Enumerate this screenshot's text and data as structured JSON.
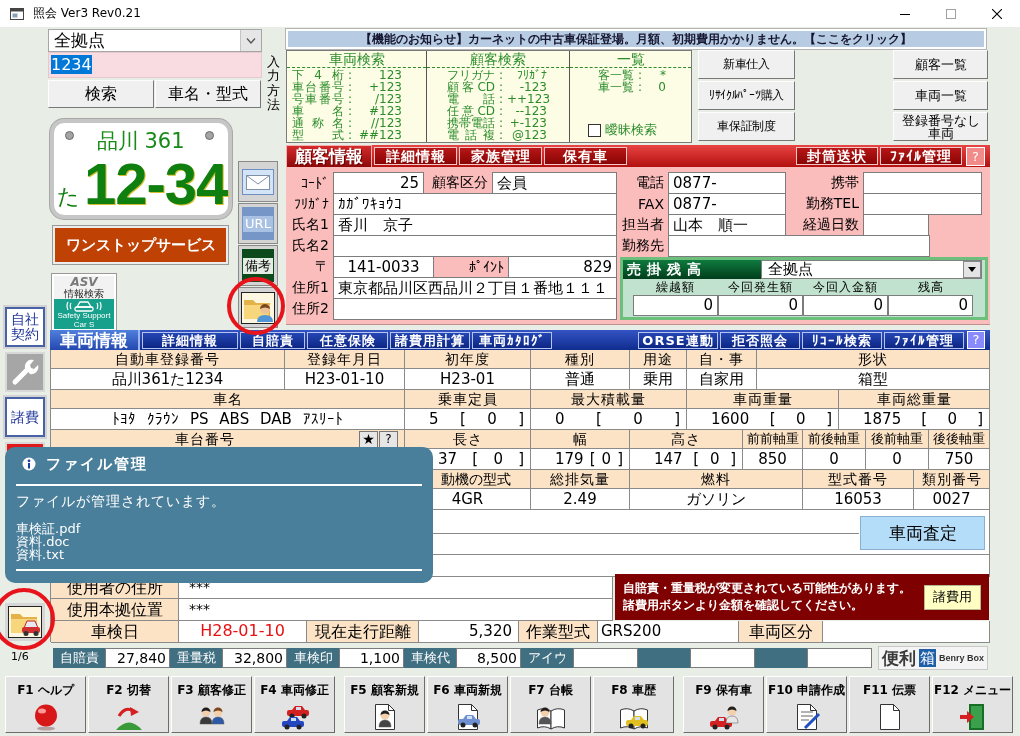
{
  "window": {
    "title": "照会 Ver3 Rev0.21"
  },
  "search": {
    "location": "全拠点",
    "query": "1234",
    "query_selected": true,
    "buttons": [
      "検索",
      "車名・型式"
    ],
    "input_method": "入力方法"
  },
  "plate": {
    "region": "品川",
    "class_number": "361",
    "kana": "た",
    "number": "12-34"
  },
  "one_stop_button": "ワンストップサービス",
  "asv_badge": {
    "title": "ASV",
    "subtitle": "情報検索",
    "caption": "Safety Support Car S"
  },
  "side_buttons": [
    {
      "kind": "mail",
      "highlighted": false
    },
    {
      "kind": "url",
      "label": "URL",
      "highlighted": false
    },
    {
      "kind": "note",
      "label": "備考",
      "highlighted": false
    },
    {
      "kind": "folder_person",
      "highlighted": true
    }
  ],
  "notice": "【機能のお知らせ】カーネットの中古車保証登場。月額、初期費用かかりません。【ここをクリック】",
  "search_help": {
    "separator": ":",
    "columns": [
      {
        "title": "車両検索",
        "entries": [
          {
            "label": "下4桁",
            "value": "123"
          },
          {
            "label": "車台番号",
            "value": "+123"
          },
          {
            "label": "号車番号",
            "value": "/123"
          },
          {
            "label": "車名",
            "value": "#123"
          },
          {
            "label": "通称名",
            "value": "//123"
          },
          {
            "label": "型式",
            "value": "##123"
          }
        ]
      },
      {
        "title": "顧客検索",
        "entries": [
          {
            "label": "フリガナ",
            "value": "ﾌﾘｶﾞﾅ"
          },
          {
            "label": "顧客CD",
            "value": "-123"
          },
          {
            "label": "電話",
            "value": "++123"
          },
          {
            "label": "任意CD",
            "value": "--123"
          },
          {
            "label": "携帯電話",
            "value": "+-123"
          },
          {
            "label": "電話複",
            "value": "@123"
          }
        ]
      },
      {
        "title": "一覧",
        "entries": [
          {
            "label": "客一覧",
            "value": "*"
          },
          {
            "label": "車一覧",
            "value": "0"
          }
        ]
      }
    ],
    "fuzzy": {
      "label": "曖昧検索",
      "checked": false
    }
  },
  "action_buttons": {
    "left": [
      "新車仕入",
      "ﾘｻｲｸﾙﾊﾟｰﾂ購入",
      "車保証制度"
    ],
    "right": [
      "顧客一覧",
      "車両一覧",
      "登録番号なし車両"
    ]
  },
  "customer": {
    "title": "顧客情報",
    "tabs": [
      "詳細情報",
      "家族管理",
      "保有車"
    ],
    "tools": [
      "封筒送状",
      "ﾌｧｲﾙ管理"
    ],
    "help": "?",
    "left_rows": [
      [
        {
          "label": "ｺｰﾄﾞ",
          "value": "25"
        },
        {
          "label": "顧客区分",
          "value": "会員"
        }
      ],
      [
        {
          "label": "ﾌﾘｶﾞﾅ",
          "value": "ｶｶﾞﾜｷｮｳｺ"
        }
      ],
      [
        {
          "label": "氏名1",
          "value": "香川　京子"
        }
      ],
      [
        {
          "label": "氏名2"
        }
      ],
      [
        {
          "label": "〒",
          "value": "141-0033"
        },
        {
          "label": "ﾎﾟｲﾝﾄ",
          "value": "829"
        }
      ],
      [
        {
          "label": "住所1",
          "value": "東京都品川区西品川２丁目１番地１１１"
        }
      ],
      [
        {
          "label": "住所2"
        }
      ]
    ],
    "right_rows": [
      [
        {
          "label": "電話",
          "value": "0877-"
        },
        {
          "label": "携帯"
        }
      ],
      [
        {
          "label": "FAX",
          "value": "0877-"
        },
        {
          "label": "勤務TEL"
        }
      ],
      [
        {
          "label": "担当者",
          "value": "山本　順一"
        },
        {
          "label": "経過日数"
        }
      ],
      [
        {
          "label": "勤務先"
        }
      ]
    ],
    "balance": {
      "title": "売掛残高",
      "location": "全拠点",
      "columns": [
        {
          "label": "繰越額",
          "value": "0"
        },
        {
          "label": "今回発生額",
          "value": "0"
        },
        {
          "label": "今回入金額",
          "value": "0"
        },
        {
          "label": "残高",
          "value": "0"
        }
      ]
    }
  },
  "left_tools": [
    {
      "kind": "contract",
      "label": "自社契約",
      "highlighted": false
    },
    {
      "kind": "wrench",
      "highlighted": false
    },
    {
      "kind": "fees",
      "label": "諸費",
      "highlighted": false
    },
    {
      "kind": "alert",
      "highlighted": false
    },
    {
      "kind": "folder_car",
      "highlighted": true
    }
  ],
  "vehicle": {
    "title": "車両情報",
    "tabs": [
      "詳細情報",
      "自賠責",
      "任意保険",
      "諸費用計算",
      "車両ｶﾀﾛｸﾞ"
    ],
    "tools": [
      "ORSE連動",
      "拒否照会",
      "ﾘｺｰﾙ検索",
      "ﾌｧｲﾙ管理"
    ],
    "help": "?",
    "bands": [
      [
        {
          "kind": "text",
          "label": "自動車登録番号",
          "value": "品川361た1234"
        },
        {
          "kind": "text",
          "label": "登録年月日",
          "value": "H23-01-10"
        },
        {
          "kind": "text",
          "label": "初年度",
          "value": "H23-01"
        },
        {
          "kind": "text",
          "label": "種別",
          "value": "普通"
        },
        {
          "kind": "text",
          "label": "用途",
          "value": "乗用"
        },
        {
          "kind": "text",
          "label": "自・事",
          "value": "自家用"
        },
        {
          "kind": "text",
          "label": "形状",
          "value": "箱型"
        }
      ],
      [
        {
          "kind": "text",
          "label": "車名",
          "value": "ﾄﾖﾀ ｸﾗｳﾝ PS ABS DAB ｱｽﾘｰﾄ"
        },
        {
          "kind": "measure",
          "label": "乗車定員",
          "value": "5 [ 0 ]"
        },
        {
          "kind": "measure",
          "label": "最大積載量",
          "value": "0 [ 0 ]"
        },
        {
          "kind": "measure",
          "label": "車両重量",
          "value": "1600 [ 0 ]"
        },
        {
          "kind": "measure",
          "label": "車両総重量",
          "value": "1875 [ 0 ]"
        }
      ],
      [
        {
          "kind": "buttons",
          "label": "車台番号",
          "buttons": [
            "★",
            "?"
          ]
        },
        {
          "kind": "measure",
          "label": "長さ",
          "value": "37 [ 0 ]"
        },
        {
          "kind": "measure",
          "label": "幅",
          "value": "179 [ 0 ]"
        },
        {
          "kind": "measure",
          "label": "高さ",
          "value": "147 [ 0 ]"
        },
        {
          "kind": "text",
          "label": "前前軸重",
          "value": "850"
        },
        {
          "kind": "text",
          "label": "前後軸重",
          "value": "0"
        },
        {
          "kind": "text",
          "label": "後前軸重",
          "value": "0"
        },
        {
          "kind": "text",
          "label": "後後軸重",
          "value": "750"
        }
      ],
      [
        {
          "kind": "text",
          "label": "動機の型式",
          "value": "4GR"
        },
        {
          "kind": "text",
          "label": "総排気量",
          "value": "2.49"
        },
        {
          "kind": "text",
          "label": "燃料",
          "value": "ガソリン"
        },
        {
          "kind": "text",
          "label": "型式番号",
          "value": "16053"
        },
        {
          "kind": "text",
          "label": "類別番号",
          "value": "0027"
        }
      ]
    ],
    "appraisal_button": "車両査定",
    "user_rows": [
      {
        "label": "使用者の住所",
        "value": "***"
      },
      {
        "label": "使用本拠位置",
        "value": "***"
      }
    ],
    "warning": {
      "lines": [
        "自賠責・重量税が変更されている可能性があります。",
        "諸費用ボタンより金額を確認してください。"
      ],
      "button": "諸費用"
    },
    "inspection_row": [
      {
        "label": "車検日",
        "value": "H28-01-10",
        "alert": true
      },
      {
        "label": "現在走行距離",
        "value": "5,320",
        "alert": false
      },
      {
        "label": "作業型式",
        "value": "GRS200",
        "alert": false
      },
      {
        "label": "車両区分"
      }
    ]
  },
  "file_tooltip": {
    "title": "ファイル管理",
    "message": "ファイルが管理されています。",
    "files": [
      "車検証.pdf",
      "資料.doc",
      "資料.txt"
    ]
  },
  "page_indicator": "1/6",
  "fees": [
    {
      "kind": "pair",
      "label": "自賠責",
      "value": "27,840"
    },
    {
      "kind": "pair",
      "label": "重量税",
      "value": "32,800"
    },
    {
      "kind": "pair",
      "label": "車検印",
      "value": "1,100"
    },
    {
      "kind": "pair",
      "label": "車検代",
      "value": "8,500"
    },
    {
      "kind": "pair",
      "label": "アイウ"
    },
    {
      "kind": "blank"
    },
    {
      "kind": "blank"
    }
  ],
  "logo": {
    "text": "便利",
    "mark": "箱",
    "caption": "Benry Box"
  },
  "function_keys": [
    {
      "label": "F1 ヘルプ",
      "kind": "help"
    },
    {
      "label": "F2 切替",
      "kind": "switch"
    },
    {
      "label": "F3 顧客修正",
      "kind": "customers"
    },
    {
      "label": "F4 車両修正",
      "kind": "cars"
    },
    {
      "label": "F5 顧客新規",
      "kind": "customer_doc"
    },
    {
      "label": "F6 車両新規",
      "kind": "car_doc"
    },
    {
      "label": "F7 台帳",
      "kind": "ledger"
    },
    {
      "label": "F8 車歴",
      "kind": "car_history"
    },
    {
      "label": "F9 保有車",
      "kind": "owned_car"
    },
    {
      "label": "F10 申請作成",
      "kind": "application"
    },
    {
      "label": "F11 伝票",
      "kind": "slip"
    },
    {
      "label": "F12 メニュー",
      "kind": "exit"
    }
  ]
}
